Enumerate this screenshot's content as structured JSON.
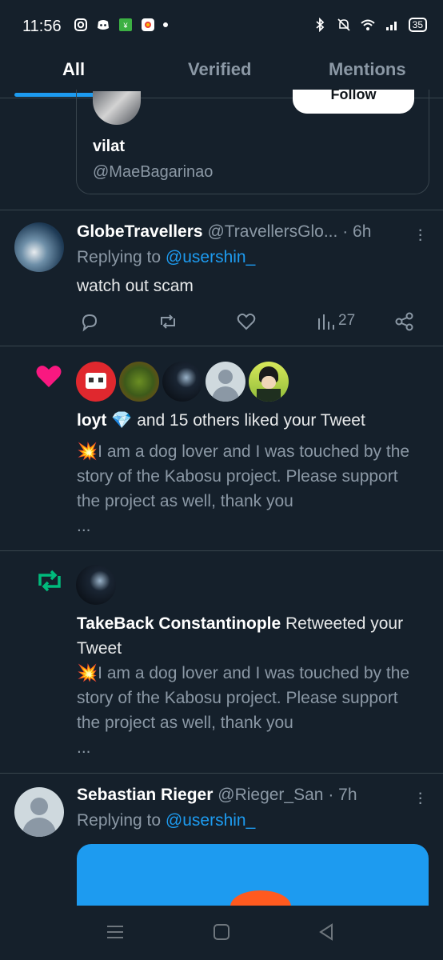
{
  "status_bar": {
    "time": "11:56",
    "battery": "35"
  },
  "tabs": [
    {
      "label": "All",
      "active": true
    },
    {
      "label": "Verified",
      "active": false
    },
    {
      "label": "Mentions",
      "active": false
    }
  ],
  "suggested_card": {
    "name": "vilat",
    "handle": "@MaeBagarinao",
    "follow_label": "Follow"
  },
  "reply1": {
    "name": "GlobeTravellers",
    "handle": "@TravellersGlo...",
    "time": "· 6h",
    "replying_prefix": "Replying to",
    "replying_user": "@usershin_",
    "text": "watch out scam",
    "views": "27"
  },
  "like_notif": {
    "user": "loyt",
    "emoji": "💎",
    "rest": "and 15 others liked your Tweet",
    "emoji_prefix": "💥",
    "text": "I am a dog lover and I was touched by the story of the Kabosu project. Please support the project as well, thank you",
    "ellipsis": "..."
  },
  "retweet_notif": {
    "user": "TakeBack Constantinople",
    "action": "Retweeted your Tweet",
    "emoji_prefix": "💥",
    "text": "I am a dog lover and I was touched by the story of the Kabosu project. Please support the project as well, thank you",
    "ellipsis": "..."
  },
  "reply2": {
    "name": "Sebastian Rieger",
    "handle": "@Rieger_San",
    "time": "· 7h",
    "replying_prefix": "Replying to",
    "replying_user": "@usershin_"
  },
  "colors": {
    "background": "#15202b",
    "accent": "#1d9bf0",
    "like": "#f91880",
    "retweet": "#00ba7c",
    "muted": "#8b98a5"
  }
}
